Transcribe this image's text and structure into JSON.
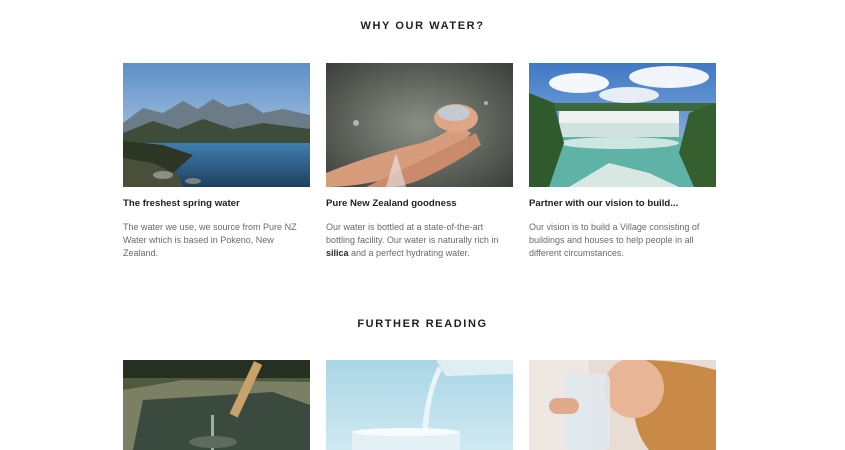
{
  "sections": {
    "why": {
      "title": "WHY OUR WATER?"
    },
    "further": {
      "title": "FURTHER READING"
    }
  },
  "cards": [
    {
      "title": "The freshest spring water",
      "text": "The water we use, we source from Pure NZ Water which is based in Pokeno, New Zealand.",
      "image_icon": "mountain-lake-photo"
    },
    {
      "title": "Pure New Zealand goodness",
      "text_before": "Our water is bottled at a state-of-the-art bottling facility.  Our water is naturally rich in ",
      "text_bold": "silica",
      "text_after": " and a perfect hydrating water.",
      "image_icon": "cupped-hands-water-photo"
    },
    {
      "title": "Partner with our vision to build...",
      "text": "Our vision is to build a Village consisting of buildings and houses to help people in all different circumstances.",
      "image_icon": "waterfall-photo"
    }
  ],
  "further_images": [
    {
      "image_icon": "bamboo-spout-photo"
    },
    {
      "image_icon": "pouring-glass-photo"
    },
    {
      "image_icon": "woman-drinking-photo"
    }
  ]
}
